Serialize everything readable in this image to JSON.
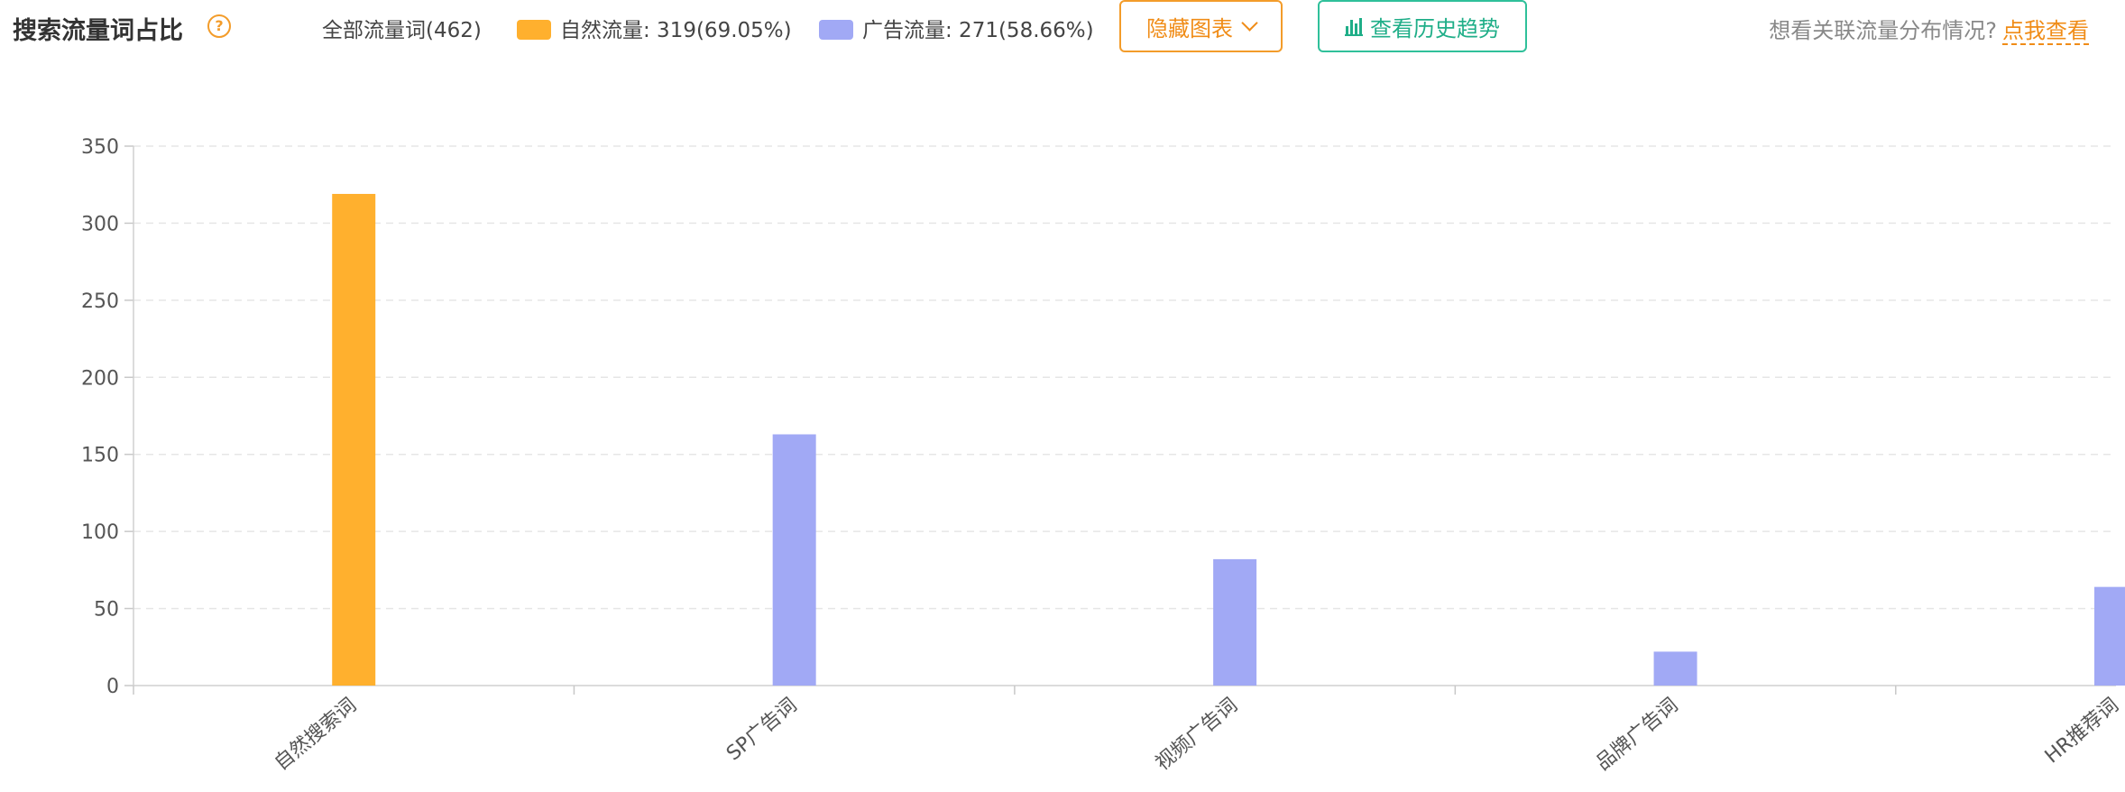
{
  "header": {
    "title": "搜索流量词占比",
    "help_icon": "question-circle-icon",
    "legend_all": "全部流量词(462)",
    "legend_natural": "自然流量: 319(69.05%)",
    "legend_ad": "广告流量: 271(58.66%)",
    "hide_chart_label": "隐藏图表",
    "history_label": "查看历史趋势",
    "hint_text": "想看关联流量分布情况?",
    "hint_link": "点我查看"
  },
  "colors": {
    "natural": "#ffb02e",
    "ad": "#a1a9f5",
    "accent_orange": "#f08c17",
    "accent_green": "#1fae88"
  },
  "chart_data": {
    "type": "bar",
    "categories": [
      "自然搜索词",
      "SP广告词",
      "视频广告词",
      "品牌广告词",
      "HR推荐词"
    ],
    "series": [
      {
        "name": "自然流量",
        "values": [
          319,
          0,
          0,
          0,
          0
        ],
        "color": "#ffb02e"
      },
      {
        "name": "广告流量",
        "values": [
          0,
          163,
          82,
          22,
          64
        ],
        "color": "#a1a9f5"
      }
    ],
    "ylim": [
      0,
      350
    ],
    "yticks": [
      0,
      50,
      100,
      150,
      200,
      250,
      300,
      350
    ],
    "grid": true
  }
}
